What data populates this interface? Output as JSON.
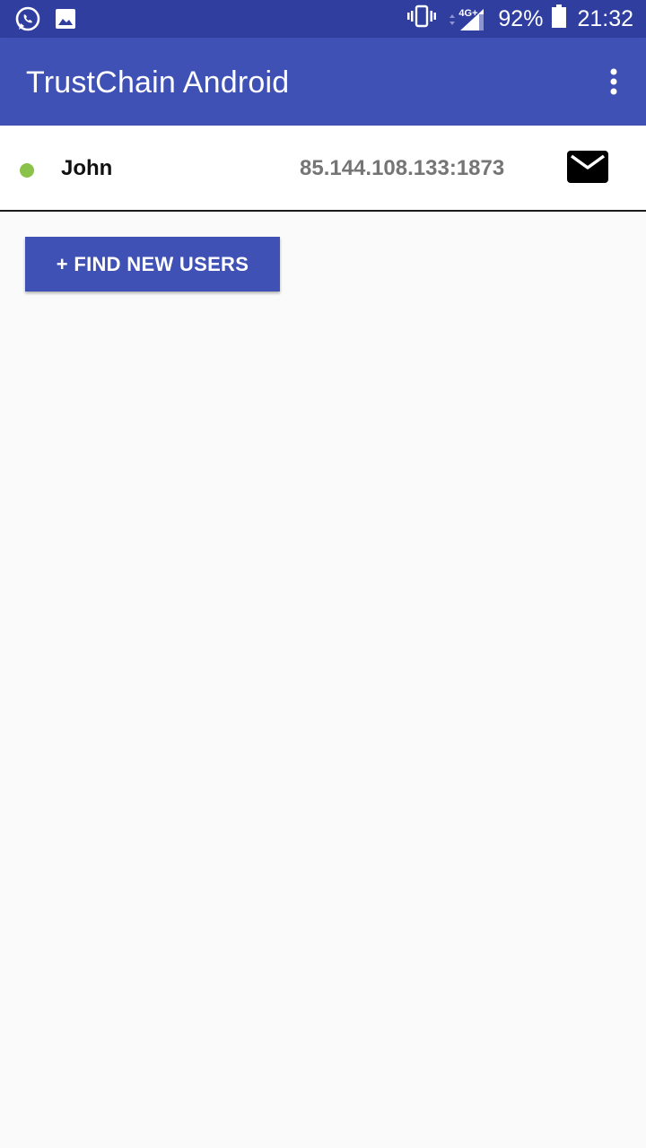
{
  "status_bar": {
    "icons_left": [
      "whatsapp-icon",
      "image-icon"
    ],
    "icons_right": [
      "vibrate-icon",
      "signal-4g-icon",
      "battery-icon"
    ],
    "network_label": "4G+",
    "battery_percent": "92%",
    "time": "21:32"
  },
  "app_bar": {
    "title": "TrustChain Android",
    "menu_icon": "more-vert-icon"
  },
  "users": [
    {
      "name": "John",
      "address": "85.144.108.133:1873",
      "online": true,
      "status_color": "#8bc34a",
      "action_icon": "mail-icon"
    }
  ],
  "actions": {
    "find_new_users_label": "+ FIND NEW USERS"
  },
  "colors": {
    "status_bar": "#303f9f",
    "primary": "#3f51b5",
    "background": "#fafafa",
    "address_text": "#757575"
  }
}
